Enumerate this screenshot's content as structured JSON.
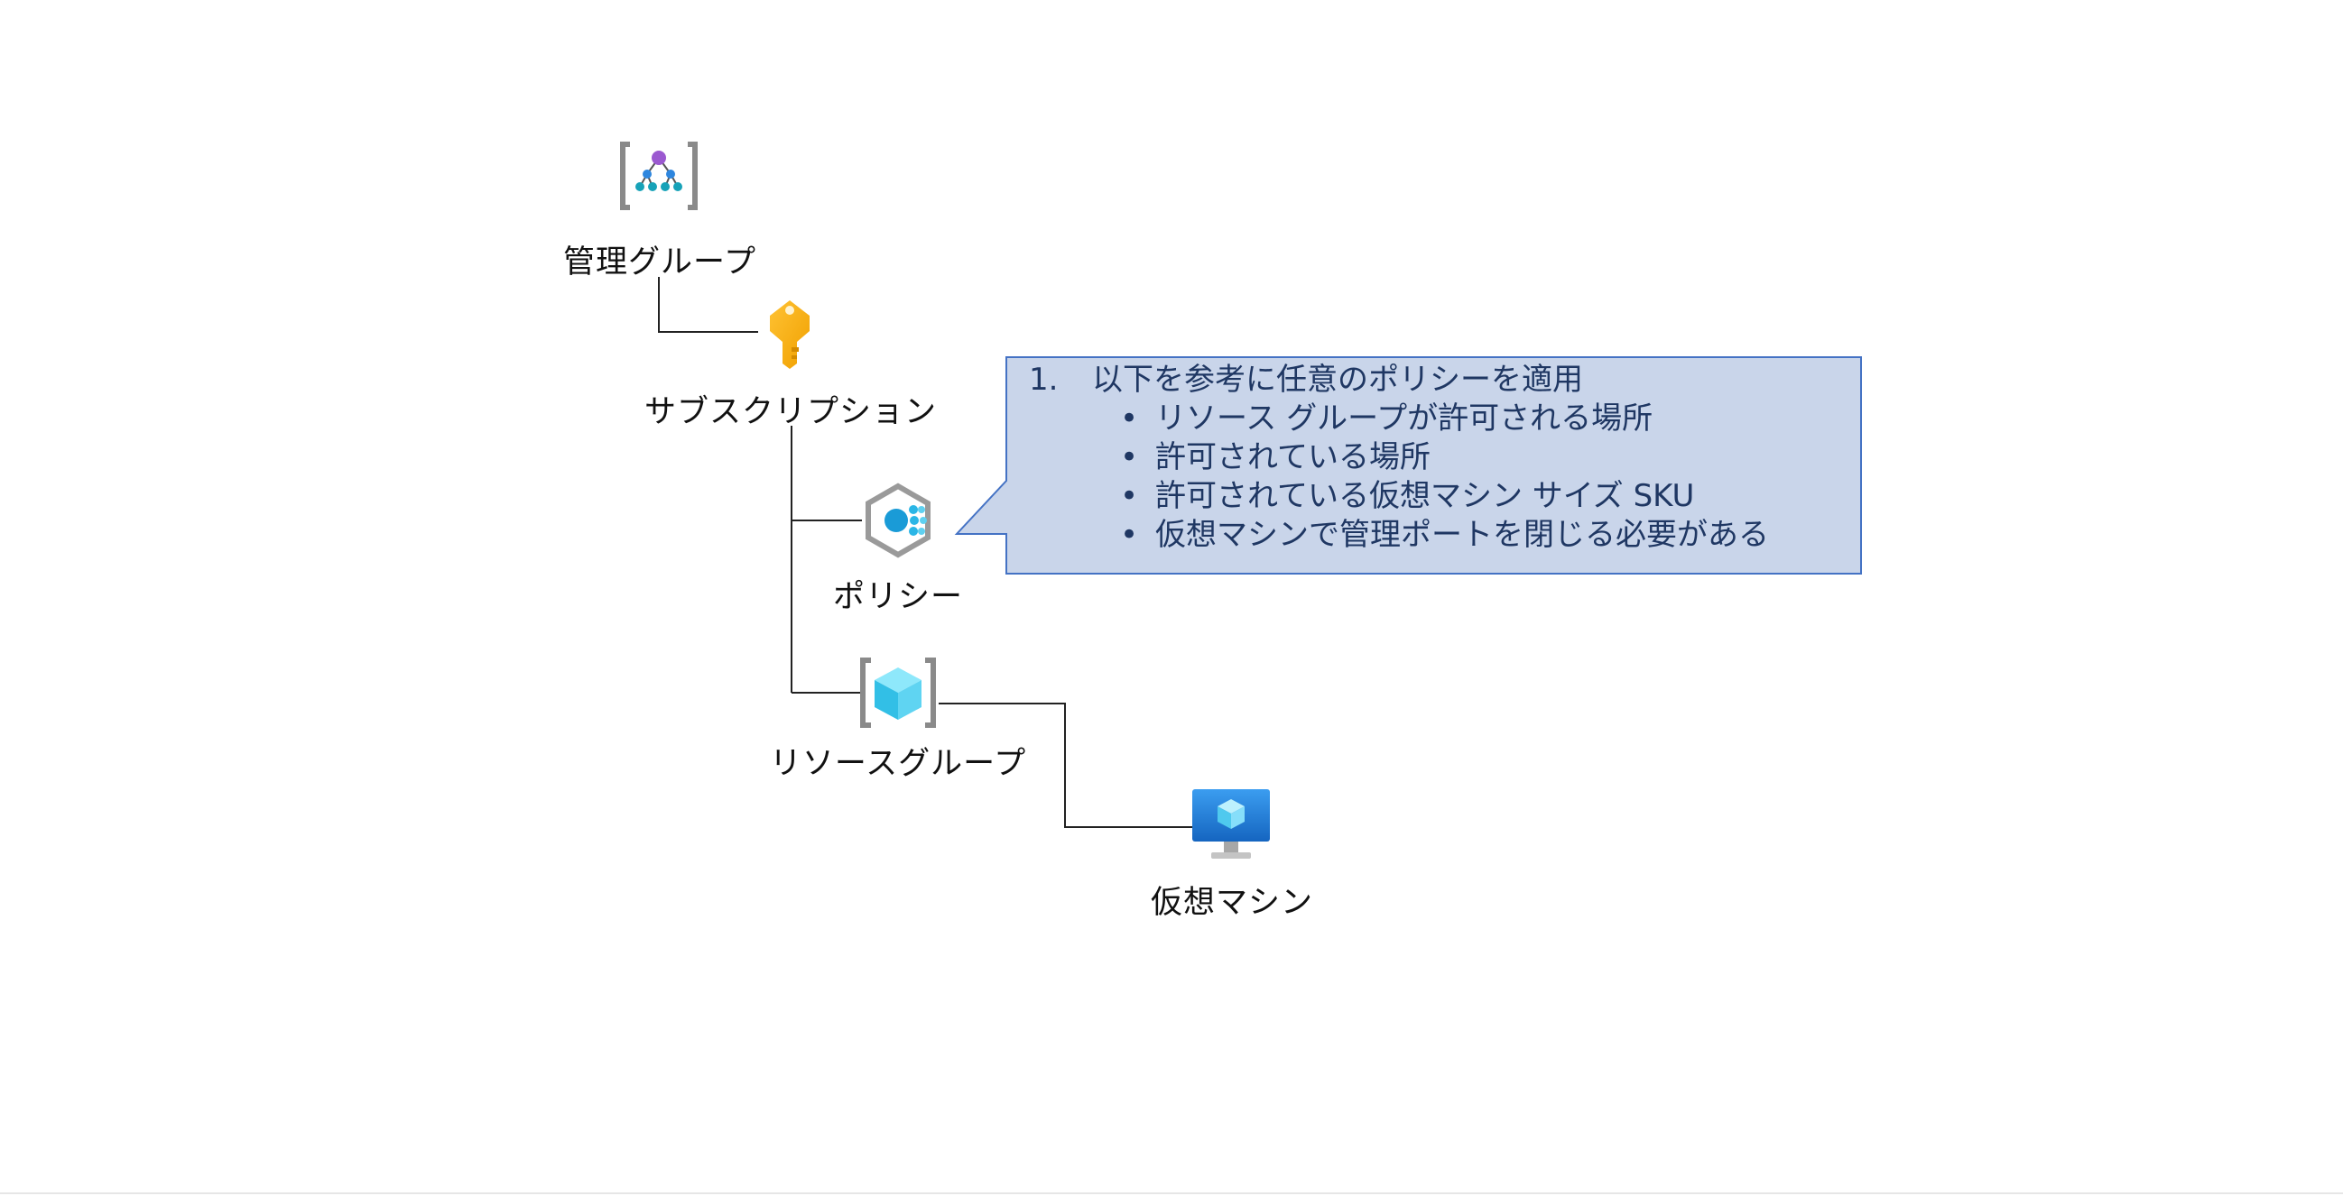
{
  "nodes": {
    "management_group": {
      "label": "管理グループ",
      "icon": "management-group-icon"
    },
    "subscription": {
      "label": "サブスクリプション",
      "icon": "key-icon"
    },
    "policy": {
      "label": "ポリシー",
      "icon": "policy-icon"
    },
    "resource_group": {
      "label": "リソースグループ",
      "icon": "resource-group-icon"
    },
    "virtual_machine": {
      "label": "仮想マシン",
      "icon": "virtual-machine-icon"
    }
  },
  "callout": {
    "number": "1.",
    "heading": "以下を参考に任意のポリシーを適用",
    "bullet": "•",
    "items": [
      "リソース グループが許可される場所",
      "許可されている場所",
      "許可されている仮想マシン サイズ SKU",
      "仮想マシンで管理ポートを閉じる必要がある"
    ],
    "fill": "#c9d5ea",
    "border": "#4472c4"
  }
}
